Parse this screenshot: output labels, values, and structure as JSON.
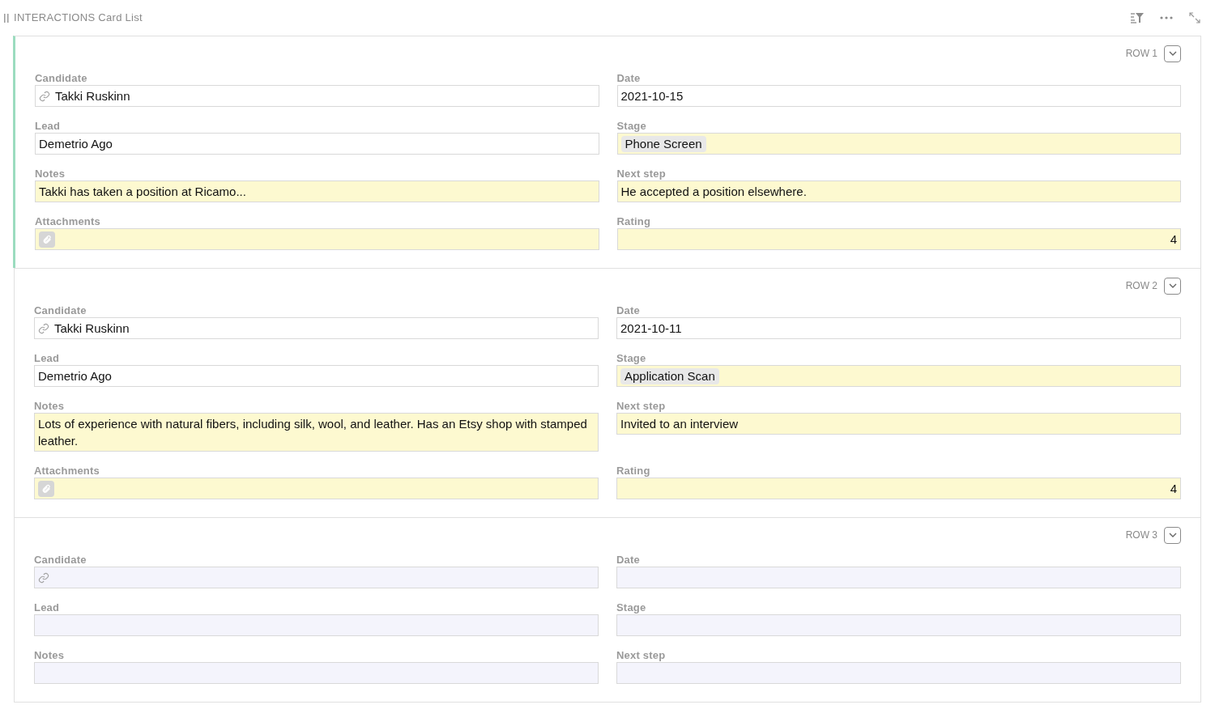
{
  "header": {
    "title": "INTERACTIONS Card List"
  },
  "cards": [
    {
      "row_label": "ROW 1",
      "selected": true,
      "fields": [
        {
          "label": "Candidate",
          "kind": "reference",
          "value": "Takki Ruskinn",
          "highlighted": false
        },
        {
          "label": "Date",
          "kind": "text",
          "value": "2021-10-15",
          "highlighted": false
        },
        {
          "label": "Lead",
          "kind": "text",
          "value": "Demetrio Ago",
          "highlighted": false
        },
        {
          "label": "Stage",
          "kind": "choice",
          "value": "Phone Screen",
          "highlighted": true
        },
        {
          "label": "Notes",
          "kind": "text",
          "value": "Takki has taken a position at Ricamo...",
          "highlighted": true
        },
        {
          "label": "Next step",
          "kind": "text",
          "value": "He accepted a position elsewhere.",
          "highlighted": true
        },
        {
          "label": "Attachments",
          "kind": "attachment",
          "highlighted": true
        },
        {
          "label": "Rating",
          "kind": "number",
          "value": "4",
          "highlighted": true
        }
      ]
    },
    {
      "row_label": "ROW 2",
      "selected": false,
      "fields": [
        {
          "label": "Candidate",
          "kind": "reference",
          "value": "Takki Ruskinn",
          "highlighted": false
        },
        {
          "label": "Date",
          "kind": "text",
          "value": "2021-10-11",
          "highlighted": false
        },
        {
          "label": "Lead",
          "kind": "text",
          "value": "Demetrio Ago",
          "highlighted": false
        },
        {
          "label": "Stage",
          "kind": "choice",
          "value": "Application Scan",
          "highlighted": true
        },
        {
          "label": "Notes",
          "kind": "text",
          "value": "Lots of experience with natural fibers, including silk, wool, and leather. Has an Etsy shop with stamped leather.",
          "highlighted": true
        },
        {
          "label": "Next step",
          "kind": "text",
          "value": "Invited to an interview",
          "highlighted": true
        },
        {
          "label": "Attachments",
          "kind": "attachment",
          "highlighted": true
        },
        {
          "label": "Rating",
          "kind": "number",
          "value": "4",
          "highlighted": true
        }
      ]
    },
    {
      "row_label": "ROW 3",
      "selected": false,
      "fields": [
        {
          "label": "Candidate",
          "kind": "reference",
          "highlighted": false
        },
        {
          "label": "Date",
          "kind": "text",
          "highlighted": false
        },
        {
          "label": "Lead",
          "kind": "text",
          "highlighted": false
        },
        {
          "label": "Stage",
          "kind": "choice",
          "highlighted": false
        },
        {
          "label": "Notes",
          "kind": "text",
          "highlighted": false
        },
        {
          "label": "Next step",
          "kind": "text",
          "highlighted": false
        }
      ]
    }
  ]
}
